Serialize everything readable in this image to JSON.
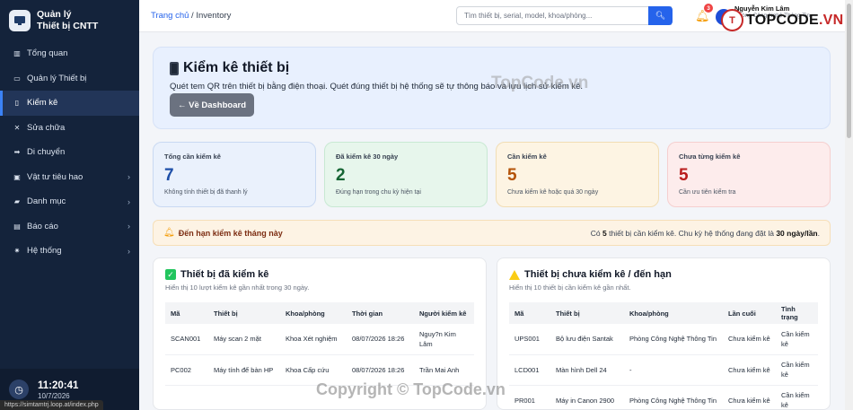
{
  "app": {
    "title_line1": "Quản lý",
    "title_line2": "Thiết bị CNTT"
  },
  "sidebar": {
    "items": [
      {
        "label": "Tổng quan",
        "icon": "chart-icon"
      },
      {
        "label": "Quản lý Thiết bị",
        "icon": "monitor-icon"
      },
      {
        "label": "Kiểm kê",
        "icon": "phone-icon",
        "active": true
      },
      {
        "label": "Sửa chữa",
        "icon": "wrench-icon"
      },
      {
        "label": "Di chuyển",
        "icon": "arrow-right-icon"
      },
      {
        "label": "Vật tư tiêu hao",
        "icon": "box-icon",
        "expandable": true
      },
      {
        "label": "Danh mục",
        "icon": "folder-icon",
        "expandable": true
      },
      {
        "label": "Báo cáo",
        "icon": "report-icon",
        "expandable": true
      },
      {
        "label": "Hệ thống",
        "icon": "gear-icon",
        "expandable": true
      }
    ]
  },
  "clock": {
    "time": "11:20:41",
    "date": "10/7/2026"
  },
  "status_url": "https://simtamtrj.loop.at/index.php",
  "header": {
    "breadcrumb_home": "Trang chủ",
    "breadcrumb_sep": " / ",
    "breadcrumb_current": "Inventory",
    "search_placeholder": "Tìm thiết bị, serial, model, khoa/phòng...",
    "notif_count": "3",
    "user_name": "Nguyễn Kim Lâm",
    "user_dept": "Phòng Công Nghệ Thông Tin"
  },
  "watermark": {
    "logo_letter": "T",
    "logo_text_a": "TOPCODE",
    "logo_text_b": ".VN",
    "mid": "TopCode.vn",
    "copyright": "Copyright © TopCode.vn"
  },
  "hero": {
    "title": "Kiểm kê thiết bị",
    "subtitle": "Quét tem QR trên thiết bị bằng điện thoại. Quét đúng thiết bị hệ thống sẽ tự thông báo và lưu lịch sử kiểm kê.",
    "back_button": "← Về Dashboard"
  },
  "stats": [
    {
      "label": "Tổng cần kiểm kê",
      "value": "7",
      "note": "Không tính thiết bị đã thanh lý",
      "bg": "#eaf1fc",
      "border": "#c9d9f2",
      "color": "#1e4fa8"
    },
    {
      "label": "Đã kiểm kê 30 ngày",
      "value": "2",
      "note": "Đúng hạn trong chu kỳ hiện tại",
      "bg": "#e7f6ec",
      "border": "#c8e9d3",
      "color": "#166534"
    },
    {
      "label": "Cần kiểm kê",
      "value": "5",
      "note": "Chưa kiểm kê hoặc quá 30 ngày",
      "bg": "#fdf4e3",
      "border": "#f1ddb4",
      "color": "#b45309"
    },
    {
      "label": "Chưa từng kiểm kê",
      "value": "5",
      "note": "Cần ưu tiên kiểm tra",
      "bg": "#fdecec",
      "border": "#f5cfcf",
      "color": "#b91c1c"
    }
  ],
  "alert": {
    "title": "Đến hạn kiểm kê tháng này",
    "msg_a": "Có ",
    "msg_count": "5",
    "msg_b": " thiết bị cần kiểm kê. Chu kỳ hệ thống đang đặt là ",
    "msg_cycle": "30 ngày/lần",
    "msg_c": "."
  },
  "checked": {
    "title": "Thiết bị đã kiểm kê",
    "subtitle": "Hiển thị 10 lượt kiểm kê gần nhất trong 30 ngày.",
    "columns": [
      "Mã",
      "Thiết bị",
      "Khoa/phòng",
      "Thời gian",
      "Người kiểm kê"
    ],
    "rows": [
      [
        "SCAN001",
        "Máy scan 2 mặt",
        "Khoa Xét nghiệm",
        "08/07/2026 18:26",
        "Nguy?n Kim Lâm"
      ],
      [
        "PC002",
        "Máy tính để bàn HP",
        "Khoa Cấp cứu",
        "08/07/2026 18:26",
        "Trần Mai Anh"
      ]
    ]
  },
  "pending": {
    "title": "Thiết bị chưa kiểm kê / đến hạn",
    "subtitle": "Hiển thị 10 thiết bị cần kiểm kê gần nhất.",
    "columns": [
      "Mã",
      "Thiết bị",
      "Khoa/phòng",
      "Lần cuối",
      "Tình trạng"
    ],
    "rows": [
      [
        "UPS001",
        "Bộ lưu điện Santak",
        "Phòng Công Nghệ Thông Tin",
        "Chưa kiểm kê",
        "Cần kiểm kê"
      ],
      [
        "LCD001",
        "Màn hình Dell 24",
        "-",
        "Chưa kiểm kê",
        "Cần kiểm kê"
      ],
      [
        "PR001",
        "Máy in Canon 2900",
        "Phòng Công Nghệ Thông Tin",
        "Chưa kiểm kê",
        "Cần kiểm kê"
      ]
    ]
  }
}
